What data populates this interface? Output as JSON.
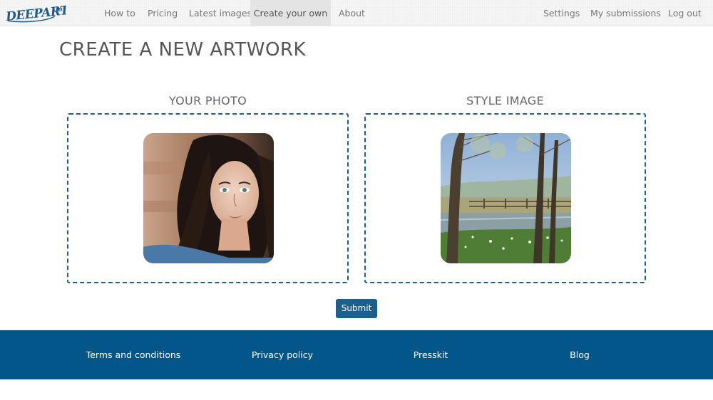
{
  "brand": {
    "logo_text": "DEEPART",
    "logo_suffix": ".io"
  },
  "nav": {
    "left": [
      {
        "label": "How to"
      },
      {
        "label": "Pricing"
      },
      {
        "label": "Latest images"
      },
      {
        "label": "Create your own",
        "active": true
      },
      {
        "label": "About"
      }
    ],
    "right": [
      {
        "label": "Settings"
      },
      {
        "label": "My submissions"
      },
      {
        "label": "Log out"
      }
    ]
  },
  "page": {
    "title": "CREATE A NEW ARTWORK"
  },
  "panels": {
    "photo": {
      "label": "YOUR PHOTO"
    },
    "style": {
      "label": "STYLE IMAGE"
    }
  },
  "actions": {
    "submit_label": "Submit"
  },
  "footer": {
    "links": [
      {
        "label": "Terms and conditions"
      },
      {
        "label": "Privacy policy"
      },
      {
        "label": "Presskit"
      },
      {
        "label": "Blog"
      }
    ]
  },
  "colors": {
    "accent": "#1d5f8c",
    "footer_bg": "#03568a",
    "nav_bg": "#f6f6f6",
    "nav_active_bg": "#e4e4e4"
  }
}
